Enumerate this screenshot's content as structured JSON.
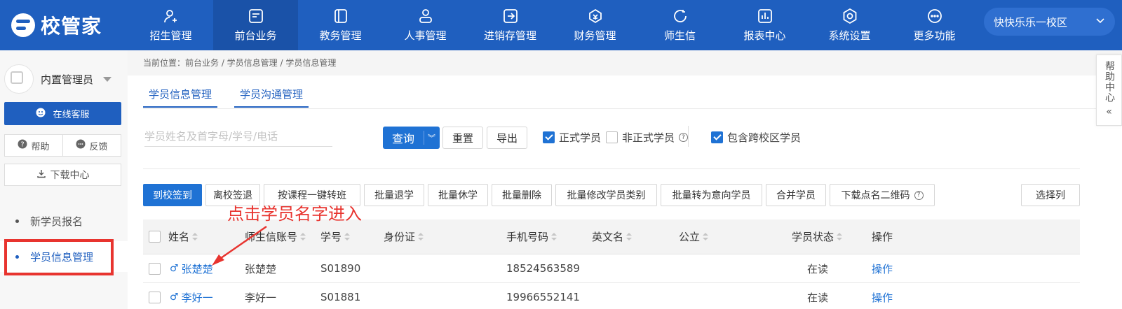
{
  "app": {
    "logo_text": "校管家"
  },
  "nav": {
    "items": [
      {
        "label": "招生管理",
        "icon": "user-plus-icon"
      },
      {
        "label": "前台业务",
        "icon": "window-icon",
        "active": true
      },
      {
        "label": "教务管理",
        "icon": "book-icon"
      },
      {
        "label": "人事管理",
        "icon": "person-icon"
      },
      {
        "label": "进销存管理",
        "icon": "transfer-icon"
      },
      {
        "label": "财务管理",
        "icon": "money-bag-icon"
      },
      {
        "label": "师生信",
        "icon": "chat-icon"
      },
      {
        "label": "报表中心",
        "icon": "chart-icon"
      },
      {
        "label": "系统设置",
        "icon": "gear-icon"
      },
      {
        "label": "更多功能",
        "icon": "more-icon"
      }
    ],
    "campus": "快快乐乐一校区"
  },
  "sidebar": {
    "user_name": "内置管理员",
    "service_label": "在线客服",
    "help_label": "帮助",
    "feedback_label": "反馈",
    "download_label": "下载中心",
    "menu": [
      {
        "label": "新学员报名",
        "active": false
      },
      {
        "label": "学员信息管理",
        "active": true
      }
    ]
  },
  "breadcrumb": "当前位置：前台业务 / 学员信息管理 / 学员信息管理",
  "tabs": [
    {
      "label": "学员信息管理"
    },
    {
      "label": "学员沟通管理"
    }
  ],
  "search": {
    "placeholder": "学员姓名及首字母/学号/电话",
    "query_label": "查询",
    "reset_label": "重置",
    "export_label": "导出",
    "filters": [
      {
        "label": "正式学员",
        "checked": true
      },
      {
        "label": "非正式学员",
        "checked": false
      },
      {
        "label": "包含跨校区学员",
        "checked": true
      }
    ]
  },
  "actions": {
    "checkin": "到校签到",
    "checkout": "离校签退",
    "transfer": "按课程一键转班",
    "batch_drop": "批量退学",
    "batch_suspend": "批量休学",
    "batch_delete": "批量删除",
    "batch_modify": "批量修改学员类别",
    "batch_to_intent": "批量转为意向学员",
    "merge": "合并学员",
    "download_qr": "下载点名二维码",
    "select_columns": "选择列"
  },
  "annotation": "点击学员名字进入",
  "table": {
    "headers": {
      "name": "姓名",
      "account": "师生信账号",
      "student_no": "学号",
      "id_card": "身份证",
      "phone": "手机号码",
      "english_name": "英文名",
      "school": "公立",
      "status": "学员状态",
      "ops": "操作"
    },
    "rows": [
      {
        "gender": "♂",
        "name": "张楚楚",
        "account": "张楚楚",
        "student_no": "S01890",
        "phone": "18524563589",
        "status": "在读",
        "ops": "操作"
      },
      {
        "gender": "♂",
        "name": "李好一",
        "account": "李好一",
        "student_no": "S01881",
        "phone": "19966552141",
        "status": "在读",
        "ops": "操作"
      }
    ]
  },
  "help_center": {
    "label": "帮助中心",
    "collapse": "«"
  },
  "colors": {
    "primary": "#1f5fbf",
    "button": "#1f72d4",
    "annotation": "#e8342f"
  }
}
